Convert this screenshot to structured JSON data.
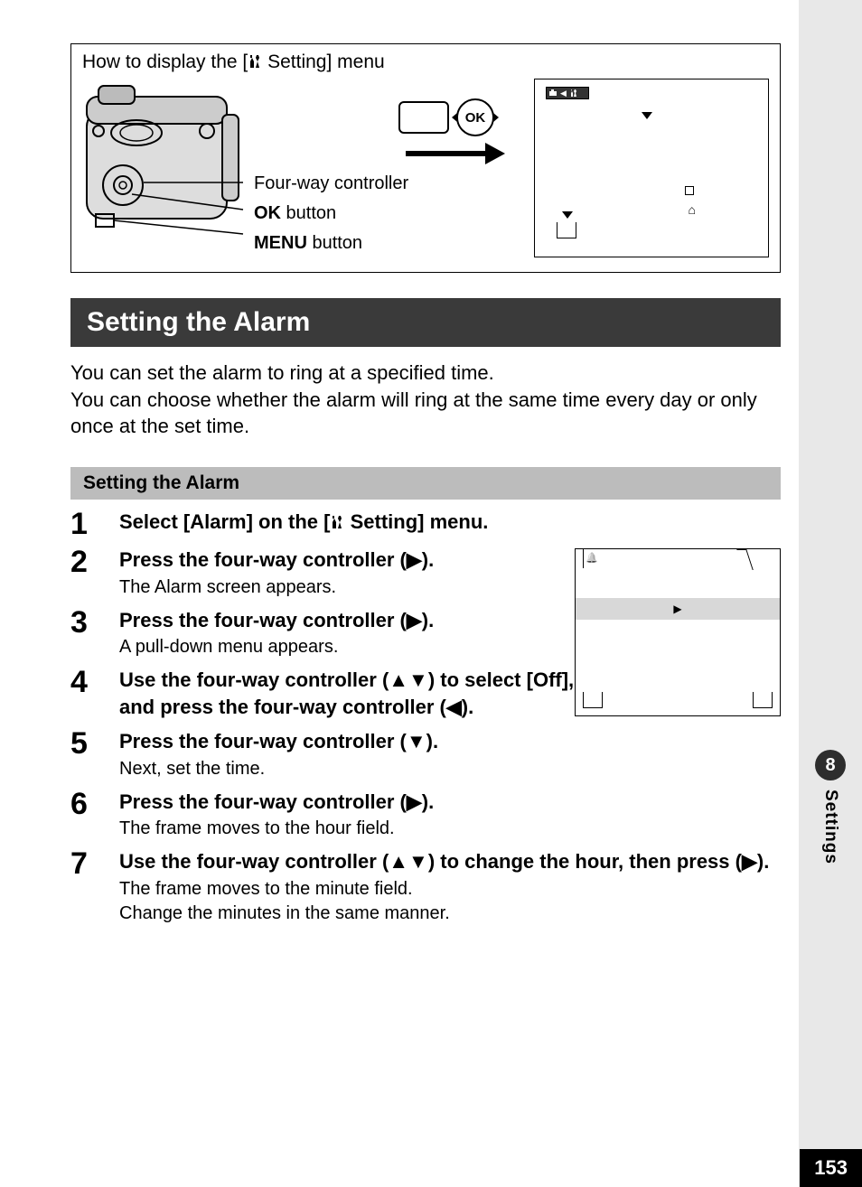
{
  "box": {
    "title_pre": "How to display the [",
    "title_post": " Setting] menu",
    "label_fourway": "Four-way controller",
    "label_ok_bold": "OK",
    "label_ok_rest": " button",
    "label_menu_bold": "MENU",
    "label_menu_rest": " button",
    "ok_text": "OK"
  },
  "header": "Setting the Alarm",
  "intro": "You can set the alarm to ring at a specified time.\nYou can choose whether the alarm will ring at the same time every day or only once at the set time.",
  "sub_header": "Setting the Alarm",
  "steps": [
    {
      "n": "1",
      "title_pre": "Select [Alarm] on the [",
      "title_post": " Setting] menu.",
      "sub": ""
    },
    {
      "n": "2",
      "title": "Press the four-way controller (▶).",
      "sub": "The Alarm screen appears."
    },
    {
      "n": "3",
      "title": "Press the four-way controller (▶).",
      "sub": "A pull-down menu appears."
    },
    {
      "n": "4",
      "title": "Use the four-way controller (▲▼) to select [Off], [Once] or [Everyday] and press the four-way controller (◀).",
      "sub": ""
    },
    {
      "n": "5",
      "title": "Press the four-way controller (▼).",
      "sub": "Next, set the time."
    },
    {
      "n": "6",
      "title": "Press the four-way controller (▶).",
      "sub": "The frame moves to the hour field."
    },
    {
      "n": "7",
      "title": "Use the four-way controller (▲▼) to change the hour, then press (▶).",
      "sub": "The frame moves to the minute field.\nChange the minutes in the same manner."
    }
  ],
  "side": {
    "chapter": "8",
    "label": "Settings"
  },
  "page_number": "153"
}
